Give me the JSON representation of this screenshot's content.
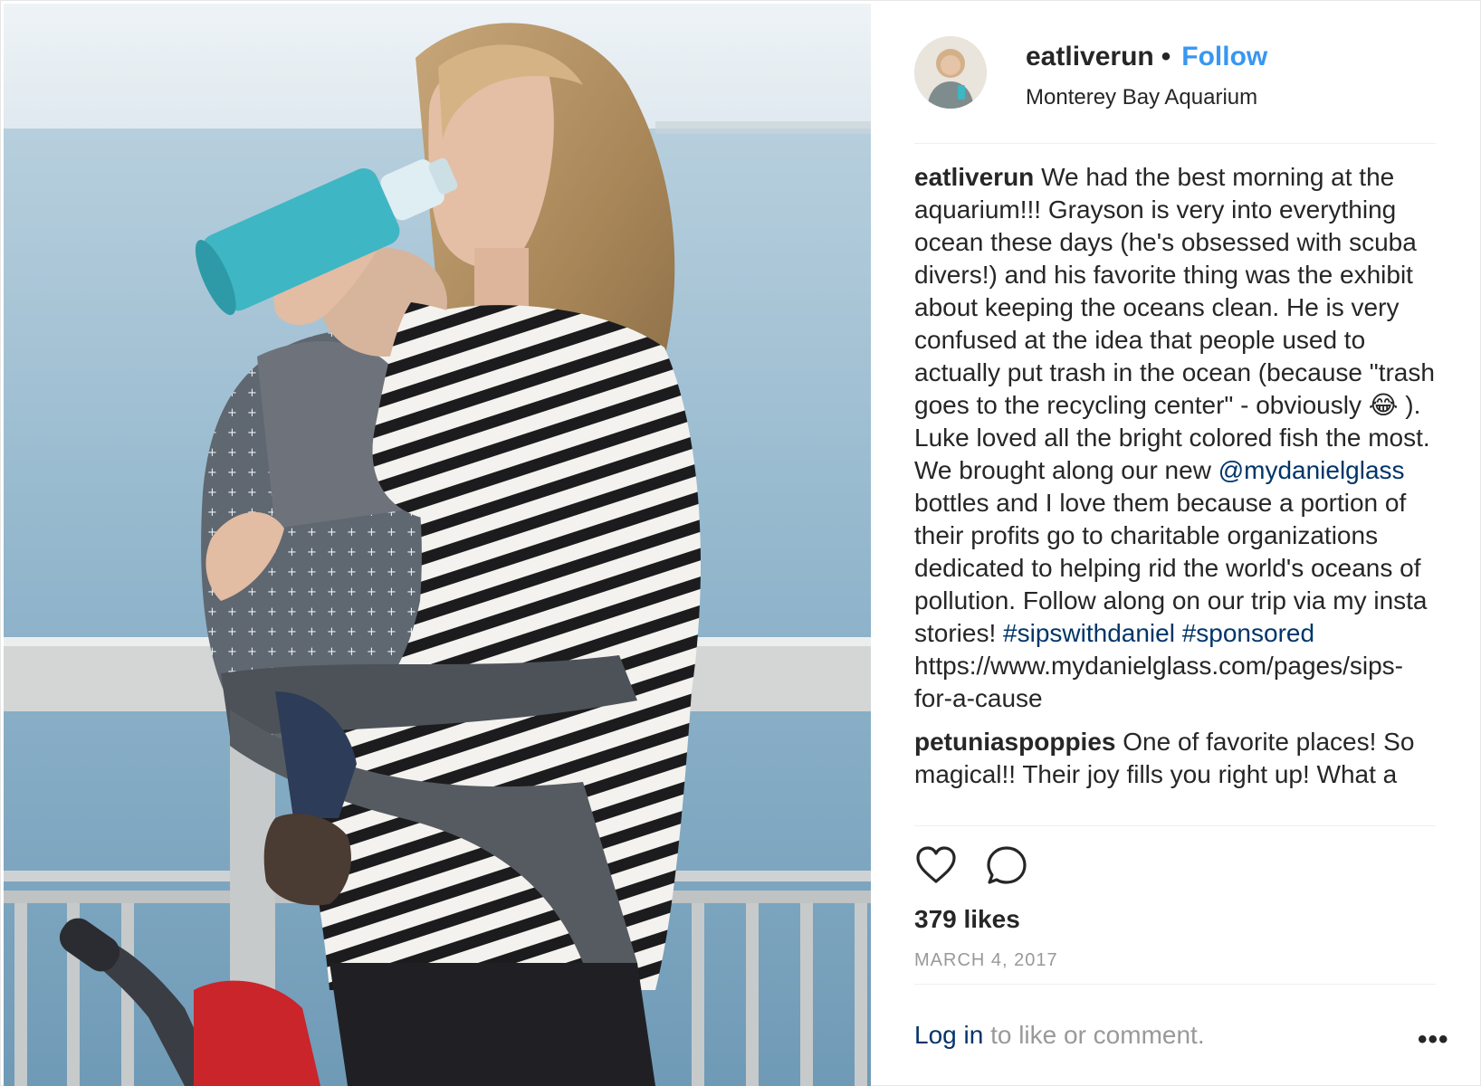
{
  "post": {
    "username": "eatliverun",
    "separator": "•",
    "follow_label": "Follow",
    "location": "Monterey Bay Aquarium",
    "caption": {
      "username": "eatliverun",
      "text_part1": "We had the best morning at the aquarium!!! Grayson is very into everything ocean these days (he's obsessed with scuba divers!) and his favorite thing was the exhibit about keeping the oceans clean. He is very confused at the idea that people used to actually put trash in the ocean (because \"trash goes to the recycling center\" - obviously 😂 ). Luke loved all the bright colored fish the most.\nWe brought along our new ",
      "mention": "@mydanielglass",
      "text_part2": " bottles and I love them because a portion of their profits go to charitable organizations dedicated to helping rid the world's oceans of pollution. Follow along on our trip via my insta stories! ",
      "hashtag1": "#sipswithdaniel",
      "hashtag2": "#sponsored",
      "text_part3": "\nhttps://www.mydanielglass.com/pages/sips-for-a-cause"
    },
    "comments": [
      {
        "username": "petuniaspoppies",
        "text": "One of favorite places! So magical!! Their joy fills you right up! What a"
      }
    ],
    "likes": "379 likes",
    "date": "MARCH 4, 2017",
    "footer": {
      "login_label": "Log in",
      "rest": " to like or comment.",
      "more_label": "•••"
    },
    "icons": [
      "heart-icon",
      "comment-icon",
      "more-options-icon"
    ],
    "colors": {
      "link_blue": "#3897f0",
      "dark_link": "#003569",
      "text": "#262626",
      "muted": "#999999"
    }
  }
}
